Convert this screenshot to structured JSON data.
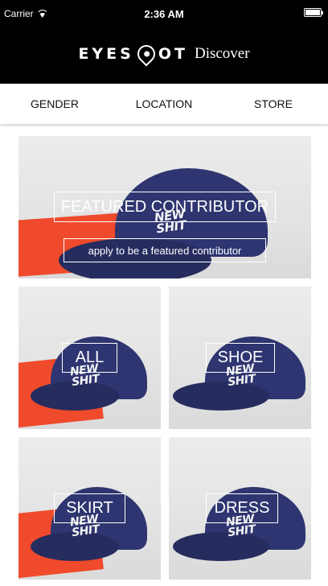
{
  "status_bar": {
    "carrier": "Carrier",
    "time": "2:36 AM"
  },
  "header": {
    "logo_text_left": "EYES",
    "logo_text_right": "OT",
    "discover_label": "Discover"
  },
  "filters": [
    {
      "label": "GENDER"
    },
    {
      "label": "LOCATION"
    },
    {
      "label": "STORE"
    }
  ],
  "featured": {
    "title": "FEATURED CONTRIBUTOR",
    "apply_label": "apply to be a featured contributor"
  },
  "categories": [
    {
      "label": "ALL"
    },
    {
      "label": "SHOE"
    },
    {
      "label": "SKIRT"
    },
    {
      "label": "DRESS"
    }
  ],
  "hat_print": {
    "line1": "NEW",
    "line2": "SHIT"
  },
  "colors": {
    "header_bg": "#000000",
    "hat_navy": "#2e3570",
    "paper_orange": "#f04a2c"
  }
}
